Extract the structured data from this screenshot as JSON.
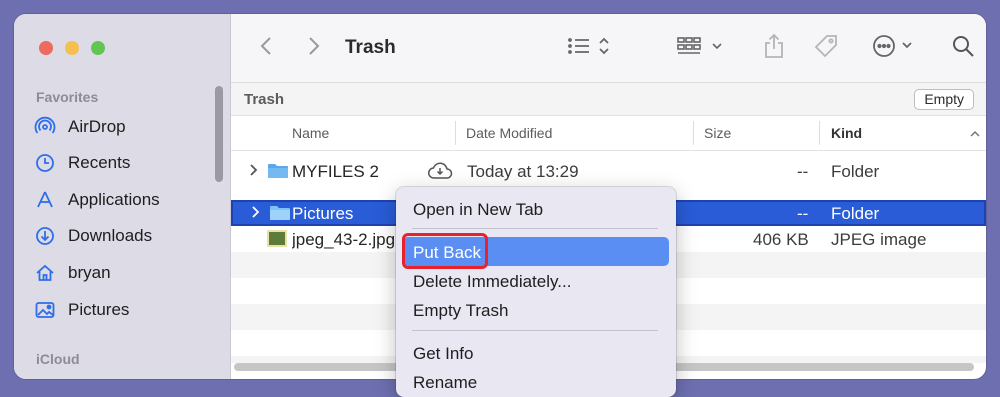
{
  "window": {
    "title": "Trash"
  },
  "sidebar": {
    "favorites_header": "Favorites",
    "items": [
      {
        "label": "AirDrop",
        "icon": "airdrop-icon"
      },
      {
        "label": "Recents",
        "icon": "clock-icon"
      },
      {
        "label": "Applications",
        "icon": "applications-icon"
      },
      {
        "label": "Downloads",
        "icon": "download-icon"
      },
      {
        "label": "bryan",
        "icon": "home-icon"
      },
      {
        "label": "Pictures",
        "icon": "pictures-icon"
      }
    ],
    "icloud_header": "iCloud"
  },
  "pathbar": {
    "label": "Trash",
    "empty_button": "Empty"
  },
  "columns": {
    "name": "Name",
    "date": "Date Modified",
    "size": "Size",
    "kind": "Kind"
  },
  "rows": [
    {
      "name": "MYFILES 2",
      "date": "Today at 13:29",
      "size": "--",
      "kind": "Folder"
    },
    {
      "name": "Pictures",
      "date": "",
      "size": "--",
      "kind": "Folder"
    },
    {
      "name": "jpeg_43-2.jpg",
      "date": "",
      "size": "406 KB",
      "kind": "JPEG image"
    }
  ],
  "context_menu": {
    "items": [
      "Open in New Tab",
      "Put Back",
      "Delete Immediately...",
      "Empty Trash",
      "Get Info",
      "Rename"
    ],
    "highlighted": "Put Back"
  },
  "colors": {
    "selection": "#2a5cd8",
    "menu_highlight": "#5b8ef2",
    "annotation": "#e8212b",
    "accent": "#2f6ee8"
  }
}
